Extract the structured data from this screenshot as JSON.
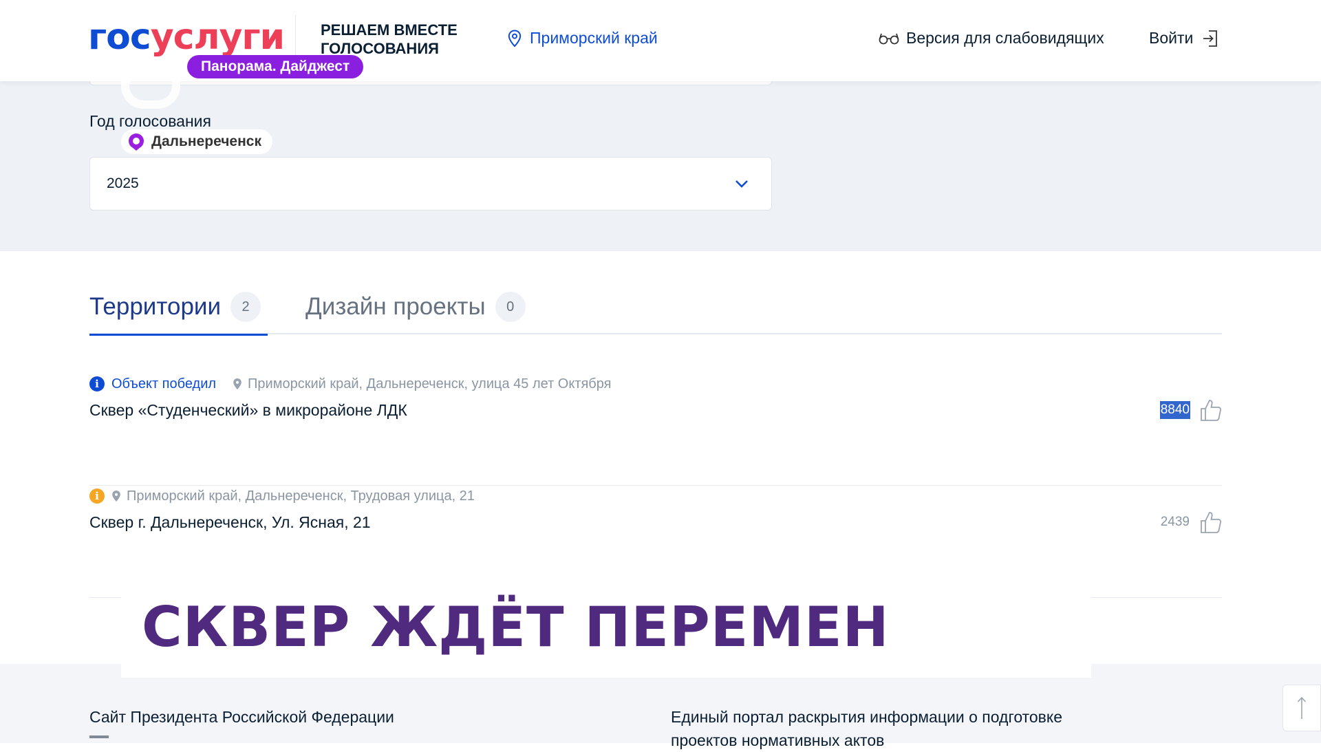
{
  "header": {
    "logo_part1": "гос",
    "logo_part2": "услуги",
    "project_title": "РЕШАЕМ ВМЕСТЕ ГОЛОСОВАНИЯ",
    "region": "Приморский край",
    "low_vision": "Версия для слабовидящих",
    "login": "Войти"
  },
  "badges": {
    "digest": "Панорама. Дайджест",
    "city": "Дальнереченск"
  },
  "filter": {
    "label": "Год голосования",
    "selected_value": "2025"
  },
  "tabs": [
    {
      "label": "Территории",
      "count": "2",
      "active": true
    },
    {
      "label": "Дизайн проекты",
      "count": "0",
      "active": false
    }
  ],
  "items": [
    {
      "status_label": "Объект победил",
      "status_color": "#0d4cd3",
      "address": "Приморский край, Дальнереченск, улица 45 лет Октября",
      "title": "Сквер «Студенческий» в микрорайоне ЛДК",
      "votes": "8840",
      "votes_selected": true
    },
    {
      "status_label": "",
      "status_color": "#f5a623",
      "address": "Приморский край, Дальнереченск, Трудовая улица, 21",
      "title": "Сквер г. Дальнереченск, Ул. Ясная, 21",
      "votes": "2439",
      "votes_selected": false
    }
  ],
  "caption": "СКВЕР ЖДЁТ ПЕРЕМЕН",
  "footer": {
    "link_left": "Сайт Президента Российской Федерации",
    "link_right": "Единый портал раскрытия информации о подготовке проектов нормативных актов"
  },
  "colors": {
    "brand_blue": "#0d4cd3",
    "brand_red": "#ee3f58",
    "caption_purple": "#4f2a7f",
    "badge_purple": "#8b1fe0"
  }
}
